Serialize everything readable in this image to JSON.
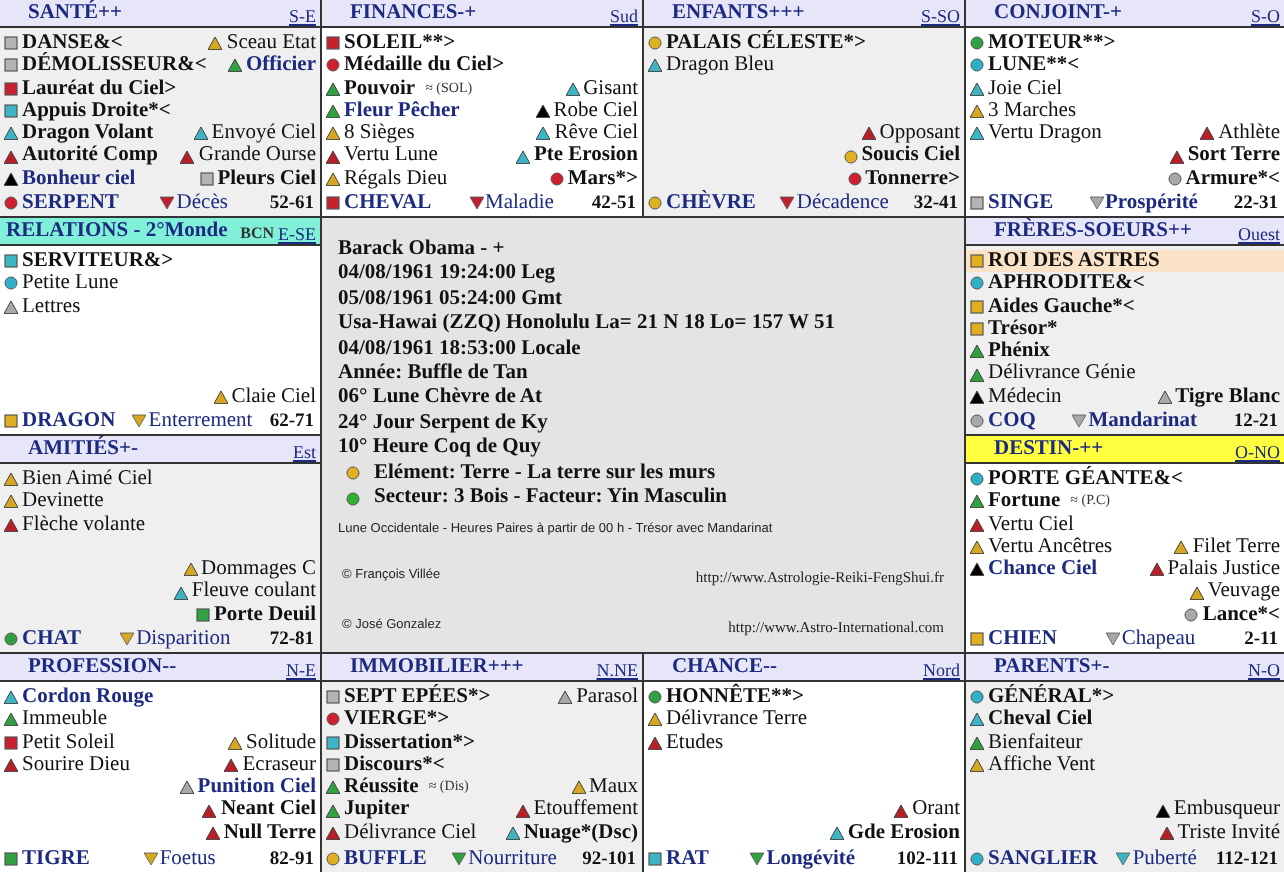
{
  "palaces": [
    {
      "title": "SANTÉ++",
      "direction": "S-E",
      "color": "#e6e6f8",
      "shaded": true,
      "stars": [
        {
          "name": "DANSE&<",
          "kind": "square",
          "color": "#b4b4b4",
          "bold": true
        },
        {
          "name": "DÉMOLISSEUR&<",
          "kind": "square",
          "color": "#b4b4b4",
          "bold": true
        },
        {
          "name": "Lauréat du Ciel>",
          "kind": "square",
          "color": "#c8202c",
          "bold": true
        },
        {
          "name": "Appuis Droite*<",
          "kind": "square",
          "color": "#3cb4c4",
          "bold": true
        },
        {
          "name": "Dragon Volant",
          "kind": "triangle",
          "color": "#3cb4c4",
          "bold": true
        },
        {
          "name": "Autorité Comp",
          "kind": "triangle",
          "color": "#b82028",
          "bold": true
        },
        {
          "name": "Bonheur ciel",
          "kind": "triangle",
          "color": "#000000",
          "bold": true,
          "emphasized": true
        }
      ],
      "side_top": [
        {
          "name": "Sceau Etat",
          "kind": "triangle",
          "color": "#d4a820",
          "bold": false
        },
        {
          "name": "Officier",
          "kind": "triangle",
          "color": "#30a040",
          "bold": true,
          "emphasized": true
        }
      ],
      "side": [
        {
          "name": "Envoyé Ciel",
          "kind": "triangle",
          "color": "#3cb4c4",
          "bold": false
        },
        {
          "name": "Grande Ourse",
          "kind": "triangle",
          "color": "#b82028",
          "bold": false
        },
        {
          "name": "Pleurs Ciel",
          "kind": "square",
          "color": "#b4b4b4",
          "bold": true
        }
      ],
      "footer": {
        "branch": {
          "name": "SERPENT",
          "kind": "circle",
          "color": "#d02030"
        },
        "deity": {
          "name": "Décès",
          "color": "#c02030",
          "bold": false
        },
        "ages": "52-61"
      }
    },
    {
      "title": "FINANCES-+",
      "direction": "Sud",
      "color": "#e6e6f8",
      "shaded": false,
      "stars": [
        {
          "name": "SOLEIL**>",
          "kind": "square",
          "color": "#c8202c",
          "bold": true
        },
        {
          "name": "Médaille du Ciel>",
          "kind": "circle",
          "color": "#d02030",
          "bold": true
        },
        {
          "name": "Pouvoir",
          "note": "≈ (SOL)",
          "kind": "triangle",
          "color": "#30a040",
          "bold": true
        },
        {
          "name": "Fleur Pêcher",
          "kind": "triangle",
          "color": "#30a040",
          "bold": true,
          "emphasized": true
        },
        {
          "name": "8 Sièges",
          "kind": "triangle",
          "color": "#d4a820",
          "bold": false
        },
        {
          "name": "Vertu Lune",
          "kind": "triangle",
          "color": "#b82028",
          "bold": false
        },
        {
          "name": "Régals Dieu",
          "kind": "triangle",
          "color": "#d4a820",
          "bold": false
        }
      ],
      "side": [
        {
          "name": "Gisant",
          "kind": "triangle",
          "color": "#3cb4c4",
          "bold": false
        },
        {
          "name": "Robe Ciel",
          "kind": "triangle",
          "color": "#000000",
          "bold": false
        },
        {
          "name": "Rêve Ciel",
          "kind": "triangle",
          "color": "#3cb4c4",
          "bold": false
        },
        {
          "name": "Pte Erosion",
          "kind": "triangle",
          "color": "#3cb4c4",
          "bold": true
        },
        {
          "name": "Mars*>",
          "kind": "circle",
          "color": "#d02030",
          "bold": true
        }
      ],
      "footer": {
        "branch": {
          "name": "CHEVAL",
          "kind": "square",
          "color": "#c8202c"
        },
        "deity": {
          "name": "Maladie",
          "color": "#c02030",
          "bold": false
        },
        "ages": "42-51"
      }
    },
    {
      "title": "ENFANTS+++",
      "direction": "S-SO",
      "color": "#e6e6f8",
      "shaded": true,
      "stars": [
        {
          "name": "PALAIS CÉLESTE*>",
          "kind": "circle",
          "color": "#e0b020",
          "bold": true
        },
        {
          "name": "Dragon Bleu",
          "kind": "triangle",
          "color": "#3cb4c4",
          "bold": false
        }
      ],
      "side": [
        {
          "name": "Opposant",
          "kind": "triangle",
          "color": "#b82028",
          "bold": false
        },
        {
          "name": "Soucis Ciel",
          "kind": "circle",
          "color": "#e0b020",
          "bold": true
        },
        {
          "name": "Tonnerre>",
          "kind": "circle",
          "color": "#d02030",
          "bold": true
        }
      ],
      "footer": {
        "branch": {
          "name": "CHÈVRE",
          "kind": "circle",
          "color": "#e0b020"
        },
        "deity": {
          "name": "Décadence",
          "color": "#c02030",
          "bold": false
        },
        "ages": "32-41"
      }
    },
    {
      "title": "CONJOINT-+",
      "direction": "S-O",
      "color": "#e6e6f8",
      "shaded": false,
      "stars": [
        {
          "name": "MOTEUR**>",
          "kind": "circle",
          "color": "#30a040",
          "bold": true
        },
        {
          "name": "LUNE**<",
          "kind": "circle",
          "color": "#30b0c8",
          "bold": true
        },
        {
          "name": "Joie Ciel",
          "kind": "triangle",
          "color": "#3cb4c4",
          "bold": false
        },
        {
          "name": "3 Marches",
          "kind": "triangle",
          "color": "#d4a820",
          "bold": false
        },
        {
          "name": "Vertu Dragon",
          "kind": "triangle",
          "color": "#3cb4c4",
          "bold": false
        }
      ],
      "side": [
        {
          "name": "Athlète",
          "kind": "triangle",
          "color": "#b82028",
          "bold": false
        },
        {
          "name": "Sort Terre",
          "kind": "triangle",
          "color": "#b82028",
          "bold": true
        },
        {
          "name": "Armure*<",
          "kind": "circle",
          "color": "#a8a8a8",
          "bold": true
        }
      ],
      "footer": {
        "branch": {
          "name": "SINGE",
          "kind": "square",
          "color": "#b4b4b4"
        },
        "deity": {
          "name": "Prospérité",
          "color": "#a8a8a8",
          "bold": true
        },
        "ages": "22-31"
      }
    },
    {
      "title": "RELATIONS - 2°Monde",
      "direction": "E-SE",
      "extra": "BCN",
      "color": "#80f0d8",
      "shaded": false,
      "stars": [
        {
          "name": "SERVITEUR&>",
          "kind": "square",
          "color": "#3cb4c4",
          "bold": true
        },
        {
          "name": "Petite Lune",
          "kind": "circle",
          "color": "#30b0c8",
          "bold": false
        },
        {
          "name": "Lettres",
          "kind": "triangle",
          "color": "#a8a8a8",
          "bold": false
        }
      ],
      "side": [
        {
          "name": "Claie Ciel",
          "kind": "triangle",
          "color": "#d4a820",
          "bold": false
        }
      ],
      "footer": {
        "branch": {
          "name": "DRAGON",
          "kind": "square",
          "color": "#e0b020"
        },
        "deity": {
          "name": "Enterrement",
          "color": "#d4a820",
          "bold": false
        },
        "ages": "62-71"
      }
    },
    {
      "title": "FRÈRES-SOEURS++",
      "direction": "Ouest",
      "color": "#e6e6f8",
      "shaded": true,
      "banner": {
        "name": "ROI DES ASTRES",
        "kind": "square",
        "color": "#e0b020",
        "bold": true
      },
      "stars": [
        {
          "name": "APHRODITE&<",
          "kind": "circle",
          "color": "#30b0c8",
          "bold": true
        },
        {
          "name": "Aides Gauche*<",
          "kind": "square",
          "color": "#e0b020",
          "bold": true
        },
        {
          "name": "Trésor*",
          "kind": "square",
          "color": "#e0b020",
          "bold": true
        },
        {
          "name": "Phénix",
          "kind": "triangle",
          "color": "#30a040",
          "bold": true
        },
        {
          "name": "Délivrance Génie",
          "kind": "triangle",
          "color": "#30a040",
          "bold": false
        },
        {
          "name": "Médecin",
          "kind": "triangle",
          "color": "#000000",
          "bold": false
        }
      ],
      "side": [
        {
          "name": "Tigre Blanc",
          "kind": "triangle",
          "color": "#a8a8a8",
          "bold": true
        }
      ],
      "footer": {
        "branch": {
          "name": "COQ",
          "kind": "circle",
          "color": "#a8a8a8"
        },
        "deity": {
          "name": "Mandarinat",
          "color": "#a8a8a8",
          "bold": true
        },
        "ages": "12-21"
      }
    },
    {
      "title": "AMITIÉS+-",
      "direction": "Est",
      "color": "#e6e6f8",
      "shaded": true,
      "stars": [
        {
          "name": "Bien Aimé Ciel",
          "kind": "triangle",
          "color": "#d4a820",
          "bold": false
        },
        {
          "name": "Devinette",
          "kind": "triangle",
          "color": "#d4a820",
          "bold": false
        },
        {
          "name": "Flèche volante",
          "kind": "triangle",
          "color": "#b82028",
          "bold": false
        }
      ],
      "side": [
        {
          "name": "Dommages C",
          "kind": "triangle",
          "color": "#d4a820",
          "bold": false
        },
        {
          "name": "Fleuve coulant",
          "kind": "triangle",
          "color": "#3cb4c4",
          "bold": false
        },
        {
          "name": "Porte Deuil",
          "kind": "square",
          "color": "#30a040",
          "bold": true
        }
      ],
      "footer": {
        "branch": {
          "name": "CHAT",
          "kind": "circle",
          "color": "#30a040"
        },
        "deity": {
          "name": "Disparition",
          "color": "#d4a820",
          "bold": false
        },
        "ages": "72-81"
      }
    },
    {
      "title": "DESTIN-++",
      "direction": "O-NO",
      "color": "#ffff40",
      "shaded": false,
      "stars": [
        {
          "name": "PORTE GÉANTE&<",
          "kind": "circle",
          "color": "#30b0c8",
          "bold": true
        },
        {
          "name": "Fortune",
          "note": "≈ (P.C)",
          "kind": "triangle",
          "color": "#30a040",
          "bold": true
        },
        {
          "name": "Vertu Ciel",
          "kind": "triangle",
          "color": "#b82028",
          "bold": false
        },
        {
          "name": "Vertu Ancêtres",
          "kind": "triangle",
          "color": "#d4a820",
          "bold": false
        },
        {
          "name": "Chance Ciel",
          "kind": "triangle",
          "color": "#000000",
          "bold": true,
          "emphasized": true
        }
      ],
      "side": [
        {
          "name": "Filet Terre",
          "kind": "triangle",
          "color": "#d4a820",
          "bold": false
        },
        {
          "name": "Palais Justice",
          "kind": "triangle",
          "color": "#b82028",
          "bold": false
        },
        {
          "name": "Veuvage",
          "kind": "triangle",
          "color": "#d4a820",
          "bold": false
        },
        {
          "name": "Lance*<",
          "kind": "circle",
          "color": "#a8a8a8",
          "bold": true
        }
      ],
      "footer": {
        "branch": {
          "name": "CHIEN",
          "kind": "square",
          "color": "#e0b020"
        },
        "deity": {
          "name": "Chapeau",
          "color": "#a8a8a8",
          "bold": false
        },
        "ages": "2-11"
      }
    },
    {
      "title": "PROFESSION--",
      "direction": "N-E",
      "color": "#e6e6f8",
      "shaded": false,
      "stars": [
        {
          "name": "Cordon Rouge",
          "kind": "triangle",
          "color": "#3cb4c4",
          "bold": true,
          "emphasized": true
        },
        {
          "name": "Immeuble",
          "kind": "triangle",
          "color": "#30a040",
          "bold": false
        },
        {
          "name": "Petit Soleil",
          "kind": "square",
          "color": "#c8202c",
          "bold": false
        },
        {
          "name": "Sourire Dieu",
          "kind": "triangle",
          "color": "#b82028",
          "bold": false
        }
      ],
      "side": [
        {
          "name": "Solitude",
          "kind": "triangle",
          "color": "#d4a820",
          "bold": false
        },
        {
          "name": "Ecraseur",
          "kind": "triangle",
          "color": "#b82028",
          "bold": false
        },
        {
          "name": "Punition Ciel",
          "kind": "triangle",
          "color": "#a8a8a8",
          "bold": true,
          "emphasized": true
        },
        {
          "name": "Neant Ciel",
          "kind": "triangle",
          "color": "#b82028",
          "bold": true
        },
        {
          "name": "Null Terre",
          "kind": "triangle",
          "color": "#b82028",
          "bold": true
        }
      ],
      "footer": {
        "branch": {
          "name": "TIGRE",
          "kind": "square",
          "color": "#30a040"
        },
        "deity": {
          "name": "Foetus",
          "color": "#d4a820",
          "bold": false
        },
        "ages": "82-91"
      }
    },
    {
      "title": "IMMOBILIER+++",
      "direction": "N.NE",
      "color": "#e6e6f8",
      "shaded": true,
      "stars": [
        {
          "name": "SEPT EPÉES*>",
          "kind": "square",
          "color": "#b4b4b4",
          "bold": true
        },
        {
          "name": "VIERGE*>",
          "kind": "circle",
          "color": "#d02030",
          "bold": true
        },
        {
          "name": "Dissertation*>",
          "kind": "square",
          "color": "#3cb4c4",
          "bold": true
        },
        {
          "name": "Discours*<",
          "kind": "square",
          "color": "#b4b4b4",
          "bold": true
        },
        {
          "name": "Réussite",
          "note": "≈ (Dis)",
          "kind": "triangle",
          "color": "#30a040",
          "bold": true
        },
        {
          "name": "Jupiter",
          "kind": "triangle",
          "color": "#30a040",
          "bold": true
        },
        {
          "name": "Délivrance Ciel",
          "kind": "triangle",
          "color": "#b82028",
          "bold": false
        }
      ],
      "side_top": [
        {
          "name": "Parasol",
          "kind": "triangle",
          "color": "#a8a8a8",
          "bold": false
        }
      ],
      "side": [
        {
          "name": "Maux",
          "kind": "triangle",
          "color": "#d4a820",
          "bold": false
        },
        {
          "name": "Etouffement",
          "kind": "triangle",
          "color": "#b82028",
          "bold": false
        },
        {
          "name": "Nuage*(Dsc)",
          "kind": "triangle",
          "color": "#3cb4c4",
          "bold": true
        }
      ],
      "footer": {
        "branch": {
          "name": "BUFFLE",
          "kind": "circle",
          "color": "#e0b020"
        },
        "deity": {
          "name": "Nourriture",
          "color": "#30a040",
          "bold": false
        },
        "ages": "92-101"
      }
    },
    {
      "title": "CHANCE--",
      "direction": "Nord",
      "color": "#e6e6f8",
      "shaded": false,
      "stars": [
        {
          "name": "HONNÊTE**>",
          "kind": "circle",
          "color": "#30a040",
          "bold": true
        },
        {
          "name": "Délivrance Terre",
          "kind": "triangle",
          "color": "#d4a820",
          "bold": false
        },
        {
          "name": "Etudes",
          "kind": "triangle",
          "color": "#b82028",
          "bold": false
        }
      ],
      "side": [
        {
          "name": "Orant",
          "kind": "triangle",
          "color": "#b82028",
          "bold": false
        },
        {
          "name": "Gde Erosion",
          "kind": "triangle",
          "color": "#3cb4c4",
          "bold": true
        }
      ],
      "footer": {
        "branch": {
          "name": "RAT",
          "kind": "square",
          "color": "#3cb4c4"
        },
        "deity": {
          "name": "Longévité",
          "color": "#30a040",
          "bold": true
        },
        "ages": "102-111"
      }
    },
    {
      "title": "PARENTS+-",
      "direction": "N-O",
      "color": "#e6e6f8",
      "shaded": true,
      "stars": [
        {
          "name": "GÉNÉRAL*>",
          "kind": "circle",
          "color": "#30b0c8",
          "bold": true
        },
        {
          "name": "Cheval Ciel",
          "kind": "triangle",
          "color": "#3cb4c4",
          "bold": true
        },
        {
          "name": "Bienfaiteur",
          "kind": "triangle",
          "color": "#30a040",
          "bold": false
        },
        {
          "name": "Affiche Vent",
          "kind": "triangle",
          "color": "#d4a820",
          "bold": false
        }
      ],
      "side": [
        {
          "name": "Embusqueur",
          "kind": "triangle",
          "color": "#000000",
          "bold": false
        },
        {
          "name": "Triste Invité",
          "kind": "triangle",
          "color": "#b82028",
          "bold": false
        }
      ],
      "footer": {
        "branch": {
          "name": "SANGLIER",
          "kind": "circle",
          "color": "#30b0c8"
        },
        "deity": {
          "name": "Puberté",
          "color": "#3cb4c4",
          "bold": false
        },
        "ages": "112-121"
      }
    }
  ],
  "center": {
    "lines": [
      "Barack Obama  - +",
      "04/08/1961 19:24:00 Leg",
      "05/08/1961 05:24:00 Gmt",
      "Usa-Hawai (ZZQ) Honolulu La= 21 N 18 Lo= 157 W 51",
      "04/08/1961 18:53:00 Locale",
      "Année: Buffle de Tan",
      "06° Lune Chèvre de At",
      "24° Jour Serpent de Ky",
      "10° Heure Coq de Quy"
    ],
    "bullets": [
      {
        "text": "Elément: Terre  - La terre sur les murs",
        "color": "#e0b020"
      },
      {
        "text": "Secteur: 3 Bois   -   Facteur: Yin Masculin",
        "color": "#30b030"
      }
    ],
    "note": "Lune Occidentale  -  Heures  Paires  à partir de 00 h  -  Trésor avec  Mandarinat",
    "credits": [
      {
        "author": "© François Villée",
        "url": "http://www.Astrologie-Reiki-FengShui.fr"
      },
      {
        "author": "© José Gonzalez",
        "url": "http://www.Astro-International.com"
      }
    ]
  }
}
